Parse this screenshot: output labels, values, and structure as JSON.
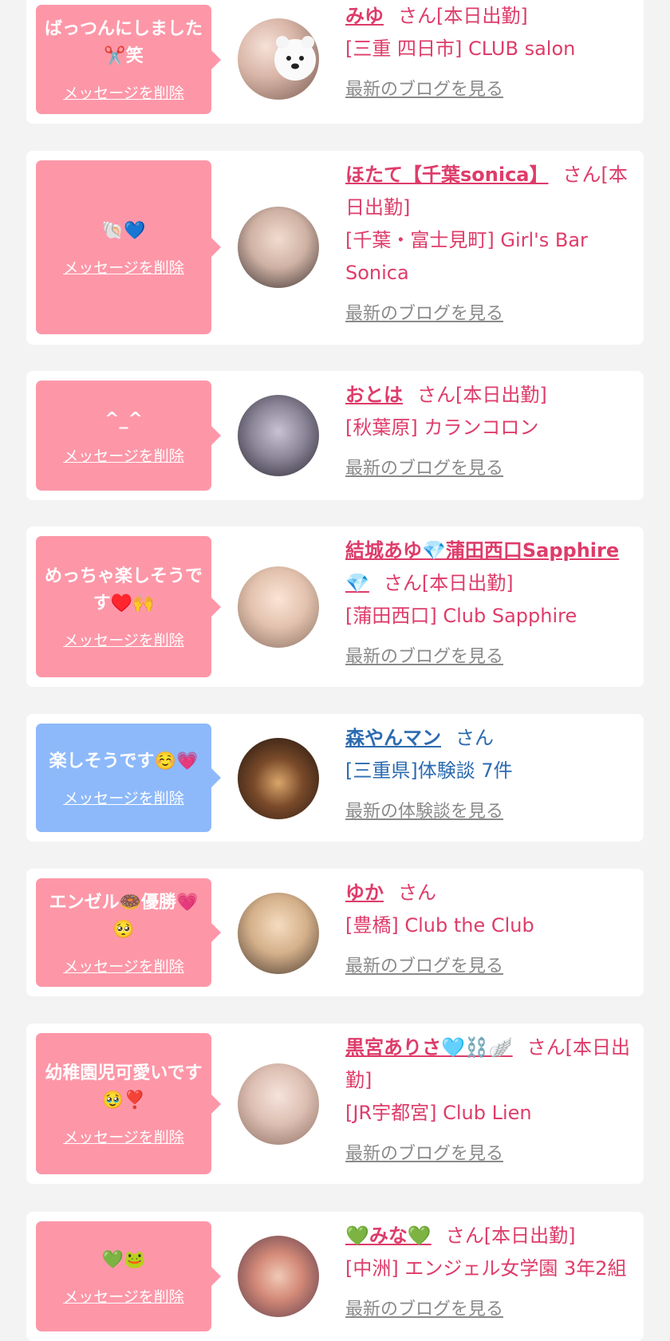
{
  "colors": {
    "pink_bubble": "#fd97a8",
    "blue_bubble": "#8db9fb",
    "name_pink": "#de3c6a",
    "name_blue": "#2c6bb0",
    "link_gray": "#8a8a8a"
  },
  "cards": [
    {
      "message": "ばっつんにしました✂️笑",
      "delete": "メッセージを削除",
      "name": "みゆ",
      "suffix": "さん[本日出勤]",
      "shop": "[三重 四日市] CLUB salon",
      "blog": "最新のブログを見る"
    },
    {
      "message": "🐚💙",
      "delete": "メッセージを削除",
      "name": "ほたて【千葉sonica】",
      "suffix": "さん[本日出勤]",
      "shop": "[千葉・富士見町] Girl's Bar Sonica",
      "blog": "最新のブログを見る"
    },
    {
      "message": "^_^",
      "delete": "メッセージを削除",
      "name": "おとは",
      "suffix": "さん[本日出勤]",
      "shop": "[秋葉原] カランコロン",
      "blog": "最新のブログを見る"
    },
    {
      "message": "めっちゃ楽しそうです♥️🙌",
      "delete": "メッセージを削除",
      "name": "結城あゆ💎蒲田西口Sapphire💎",
      "suffix": "さん[本日出勤]",
      "shop": "[蒲田西口] Club Sapphire",
      "blog": "最新のブログを見る"
    },
    {
      "message": "楽しそうです☺️💗",
      "delete": "メッセージを削除",
      "name": "森やんマン",
      "suffix": "さん",
      "shop": "[三重県]体験談 7件",
      "blog": "最新の体験談を見る"
    },
    {
      "message": "エンゼル🍩優勝💗🥺",
      "delete": "メッセージを削除",
      "name": "ゆか",
      "suffix": "さん",
      "shop": "[豊橋] Club the Club",
      "blog": "最新のブログを見る"
    },
    {
      "message": "幼稚園児可愛いです🥹❣️",
      "delete": "メッセージを削除",
      "name": "黒宮ありさ🩵⛓️🪽",
      "suffix": "さん[本日出勤]",
      "shop": "[JR宇都宮] Club Lien",
      "blog": "最新のブログを見る"
    },
    {
      "message": "💚🐸",
      "delete": "メッセージを削除",
      "name": "💚みな💚",
      "suffix": "さん[本日出勤]",
      "shop": "[中洲] エンジェル女学園 3年2組",
      "blog": "最新のブログを見る"
    }
  ]
}
